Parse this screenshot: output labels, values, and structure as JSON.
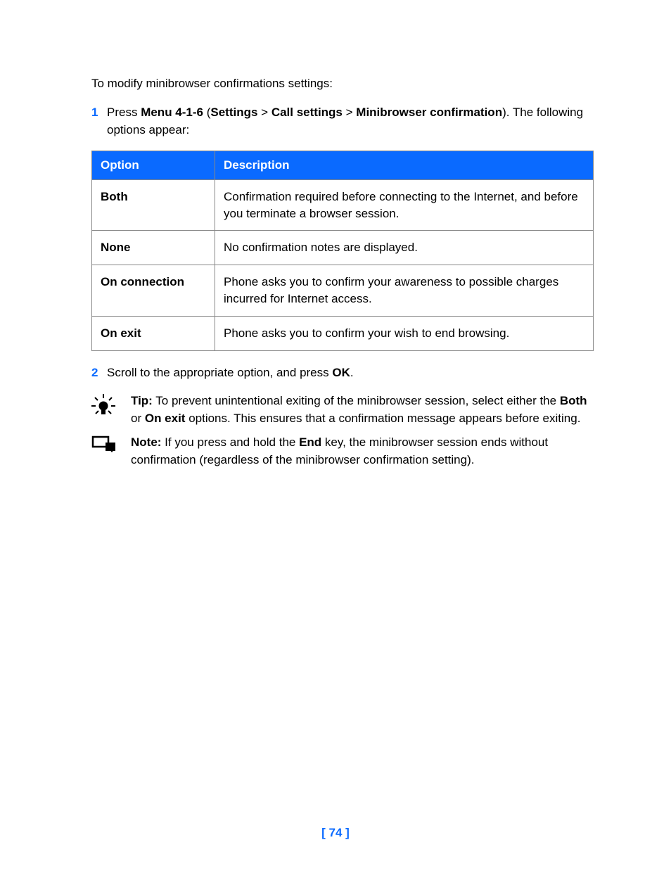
{
  "intro": "To modify minibrowser confirmations settings:",
  "steps": [
    {
      "num": "1",
      "prefix": "Press ",
      "menu": "Menu 4-1-6",
      "open": " (",
      "crumb1": "Settings",
      "sep": " > ",
      "crumb2": "Call settings",
      "crumb3": "Minibrowser confirmation",
      "close": "). The following options appear:"
    },
    {
      "num": "2",
      "prefix": "Scroll to the appropriate option, and press ",
      "ok": "OK",
      "suffix": "."
    }
  ],
  "table": {
    "headers": {
      "opt": "Option",
      "desc": "Description"
    },
    "rows": [
      {
        "opt": "Both",
        "desc": "Confirmation required before connecting to the Internet, and before you terminate a browser session."
      },
      {
        "opt": "None",
        "desc": "No confirmation notes are displayed."
      },
      {
        "opt": "On connection",
        "desc": "Phone asks you to confirm your awareness to possible charges incurred for Internet access."
      },
      {
        "opt": "On exit",
        "desc": "Phone asks you to confirm your wish to end browsing."
      }
    ]
  },
  "tip": {
    "label": "Tip:",
    "t1": " To prevent unintentional exiting of the minibrowser session, select either the ",
    "b1": "Both",
    "t2": " or ",
    "b2": "On exit",
    "t3": " options. This ensures that a confirmation message appears before exiting."
  },
  "note": {
    "label": "Note:",
    "t1": " If you press and hold the ",
    "b1": "End",
    "t2": " key, the minibrowser session ends without confirmation (regardless of the minibrowser confirmation setting)."
  },
  "pagenum": "[ 74 ]"
}
